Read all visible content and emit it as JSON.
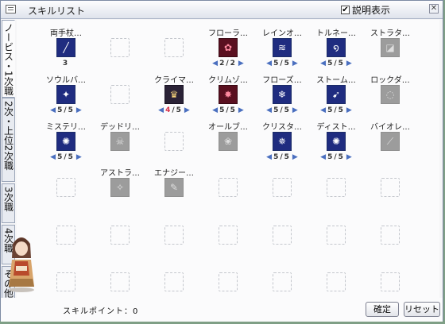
{
  "window": {
    "title": "スキルリスト",
    "description_toggle_label": "説明表示",
    "description_checked": true,
    "close_symbol": "✕"
  },
  "tabs": [
    {
      "label": "ノービス・1次職",
      "active": true
    },
    {
      "label": "2次・上位2次職",
      "active": false
    },
    {
      "label": "3次職",
      "active": false
    },
    {
      "label": "4次職",
      "active": false
    },
    {
      "label": "その他",
      "active": false
    }
  ],
  "skills": [
    {
      "row": 0,
      "col": 0,
      "name": "両手杖…",
      "state": "active",
      "icon": "two-hand-staff-icon",
      "glyph": "╱",
      "level": "3"
    },
    {
      "row": 0,
      "col": 1,
      "name": "",
      "state": "empty"
    },
    {
      "row": 0,
      "col": 2,
      "name": "",
      "state": "empty"
    },
    {
      "row": 0,
      "col": 3,
      "name": "フローラ…",
      "state": "active",
      "tone": "red",
      "icon": "flora-icon",
      "glyph": "✿",
      "level_cur": "2",
      "level_max": "2",
      "arrows": true
    },
    {
      "row": 0,
      "col": 4,
      "name": "レインオ…",
      "state": "active",
      "icon": "rain-icon",
      "glyph": "≋",
      "level_cur": "5",
      "level_max": "5",
      "arrows": true
    },
    {
      "row": 0,
      "col": 5,
      "name": "トルネー…",
      "state": "active",
      "icon": "tornado-icon",
      "glyph": "໑",
      "level_cur": "5",
      "level_max": "5",
      "arrows": true
    },
    {
      "row": 0,
      "col": 6,
      "name": "ストラタ…",
      "state": "locked",
      "icon": "strata-icon",
      "glyph": "◪"
    },
    {
      "row": 1,
      "col": 0,
      "name": "ソウルバ…",
      "state": "active",
      "icon": "soul-bolt-icon",
      "glyph": "✦",
      "level_cur": "5",
      "level_max": "5",
      "arrows": true
    },
    {
      "row": 1,
      "col": 1,
      "name": "",
      "state": "empty"
    },
    {
      "row": 1,
      "col": 2,
      "name": "クライマ…",
      "state": "active",
      "tone": "gold",
      "icon": "climax-icon",
      "glyph": "♛",
      "level_cur": "4",
      "level_max": "5",
      "arrows": true,
      "cur_red": true
    },
    {
      "row": 1,
      "col": 3,
      "name": "クリムゾ…",
      "state": "active",
      "tone": "red",
      "icon": "crimson-icon",
      "glyph": "✸",
      "level_cur": "5",
      "level_max": "5",
      "arrows": true
    },
    {
      "row": 1,
      "col": 4,
      "name": "フローズ…",
      "state": "active",
      "icon": "frozen-icon",
      "glyph": "❄",
      "level_cur": "5",
      "level_max": "5",
      "arrows": true
    },
    {
      "row": 1,
      "col": 5,
      "name": "ストーム…",
      "state": "active",
      "icon": "storm-icon",
      "glyph": "➹",
      "level_cur": "5",
      "level_max": "5",
      "arrows": true
    },
    {
      "row": 1,
      "col": 6,
      "name": "ロックダ…",
      "state": "locked",
      "icon": "rock-down-icon",
      "glyph": "◌"
    },
    {
      "row": 2,
      "col": 0,
      "name": "ミステリ…",
      "state": "active",
      "icon": "mystery-icon",
      "glyph": "✺",
      "level_cur": "5",
      "level_max": "5",
      "arrows": true
    },
    {
      "row": 2,
      "col": 1,
      "name": "デッドリ…",
      "state": "locked",
      "icon": "deadly-icon",
      "glyph": "☠"
    },
    {
      "row": 2,
      "col": 2,
      "name": "",
      "state": "empty"
    },
    {
      "row": 2,
      "col": 3,
      "name": "オールブ…",
      "state": "locked",
      "icon": "all-bloom-icon",
      "glyph": "❀"
    },
    {
      "row": 2,
      "col": 4,
      "name": "クリスタ…",
      "state": "active",
      "icon": "crystal-icon",
      "glyph": "✵",
      "level_cur": "5",
      "level_max": "5",
      "arrows": true
    },
    {
      "row": 2,
      "col": 5,
      "name": "ディスト…",
      "state": "active",
      "icon": "distortion-icon",
      "glyph": "✺",
      "level_cur": "5",
      "level_max": "5",
      "arrows": true
    },
    {
      "row": 2,
      "col": 6,
      "name": "バイオレ…",
      "state": "locked",
      "icon": "violent-icon",
      "glyph": "⟋"
    },
    {
      "row": 3,
      "col": 0,
      "name": "",
      "state": "empty"
    },
    {
      "row": 3,
      "col": 1,
      "name": "アストラ…",
      "state": "locked",
      "icon": "astral-icon",
      "glyph": "✧"
    },
    {
      "row": 3,
      "col": 2,
      "name": "エナジー…",
      "state": "locked",
      "icon": "energy-icon",
      "glyph": "✎"
    },
    {
      "row": 3,
      "col": 3,
      "name": "",
      "state": "empty"
    },
    {
      "row": 3,
      "col": 4,
      "name": "",
      "state": "empty"
    },
    {
      "row": 3,
      "col": 5,
      "name": "",
      "state": "empty"
    },
    {
      "row": 3,
      "col": 6,
      "name": "",
      "state": "empty"
    },
    {
      "row": 4,
      "col": 0,
      "name": "",
      "state": "empty"
    },
    {
      "row": 4,
      "col": 1,
      "name": "",
      "state": "empty"
    },
    {
      "row": 4,
      "col": 2,
      "name": "",
      "state": "empty"
    },
    {
      "row": 4,
      "col": 3,
      "name": "",
      "state": "empty"
    },
    {
      "row": 4,
      "col": 4,
      "name": "",
      "state": "empty"
    },
    {
      "row": 4,
      "col": 5,
      "name": "",
      "state": "empty"
    },
    {
      "row": 4,
      "col": 6,
      "name": "",
      "state": "empty"
    },
    {
      "row": 5,
      "col": 0,
      "name": "",
      "state": "empty"
    },
    {
      "row": 5,
      "col": 1,
      "name": "",
      "state": "empty"
    },
    {
      "row": 5,
      "col": 2,
      "name": "",
      "state": "empty"
    },
    {
      "row": 5,
      "col": 3,
      "name": "",
      "state": "empty"
    },
    {
      "row": 5,
      "col": 4,
      "name": "",
      "state": "empty"
    },
    {
      "row": 5,
      "col": 5,
      "name": "",
      "state": "empty"
    },
    {
      "row": 5,
      "col": 6,
      "name": "",
      "state": "empty"
    }
  ],
  "footer": {
    "skill_points": "スキルポイント：0",
    "ok_label": "確定",
    "reset_label": "リセット"
  }
}
